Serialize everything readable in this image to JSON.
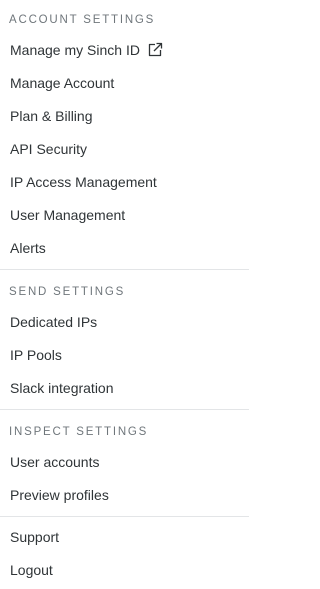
{
  "sections": [
    {
      "header": "ACCOUNT SETTINGS",
      "items": [
        {
          "label": "Manage my Sinch ID",
          "icon": "external-link-icon"
        },
        {
          "label": "Manage Account"
        },
        {
          "label": "Plan & Billing"
        },
        {
          "label": "API Security"
        },
        {
          "label": "IP Access Management"
        },
        {
          "label": "User Management"
        },
        {
          "label": "Alerts"
        }
      ]
    },
    {
      "header": "SEND SETTINGS",
      "items": [
        {
          "label": "Dedicated IPs"
        },
        {
          "label": "IP Pools"
        },
        {
          "label": "Slack integration"
        }
      ]
    },
    {
      "header": "INSPECT SETTINGS",
      "items": [
        {
          "label": "User accounts"
        },
        {
          "label": "Preview profiles"
        }
      ]
    },
    {
      "items": [
        {
          "label": "Support"
        },
        {
          "label": "Logout"
        }
      ]
    }
  ],
  "colors": {
    "text": "#2f3437",
    "header": "#6f767b",
    "divider": "#e3e5e7"
  }
}
